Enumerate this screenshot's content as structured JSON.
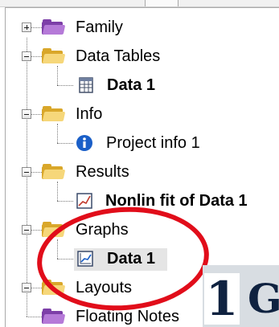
{
  "tree": {
    "items": [
      {
        "label": "Family",
        "kind": "folder",
        "expanded": false,
        "folder_color": "purple"
      },
      {
        "label": "Data Tables",
        "kind": "folder",
        "expanded": true,
        "folder_color": "yellow"
      },
      {
        "label": "Data 1",
        "kind": "leaf",
        "icon": "data-table-icon"
      },
      {
        "label": "Info",
        "kind": "folder",
        "expanded": true,
        "folder_color": "yellow"
      },
      {
        "label": "Project info 1",
        "kind": "leaf",
        "icon": "info-icon"
      },
      {
        "label": "Results",
        "kind": "folder",
        "expanded": true,
        "folder_color": "yellow"
      },
      {
        "label": "Nonlin fit of Data 1",
        "kind": "leaf",
        "icon": "results-chart-icon"
      },
      {
        "label": "Graphs",
        "kind": "folder",
        "expanded": true,
        "folder_color": "yellow"
      },
      {
        "label": "Data 1",
        "kind": "leaf",
        "icon": "graph-icon",
        "selected": true
      },
      {
        "label": "Layouts",
        "kind": "folder",
        "expanded": true,
        "folder_color": "yellow"
      },
      {
        "label": "Floating Notes",
        "kind": "folder",
        "expanded": false,
        "folder_color": "purple"
      }
    ]
  },
  "overlay": {
    "number": "1",
    "letter": "G"
  },
  "colors": {
    "annotation_red": "#e10d1a",
    "folder_yellow": "#f3c95b",
    "folder_purple": "#9b5fc0",
    "info_blue": "#1a5fc8"
  }
}
